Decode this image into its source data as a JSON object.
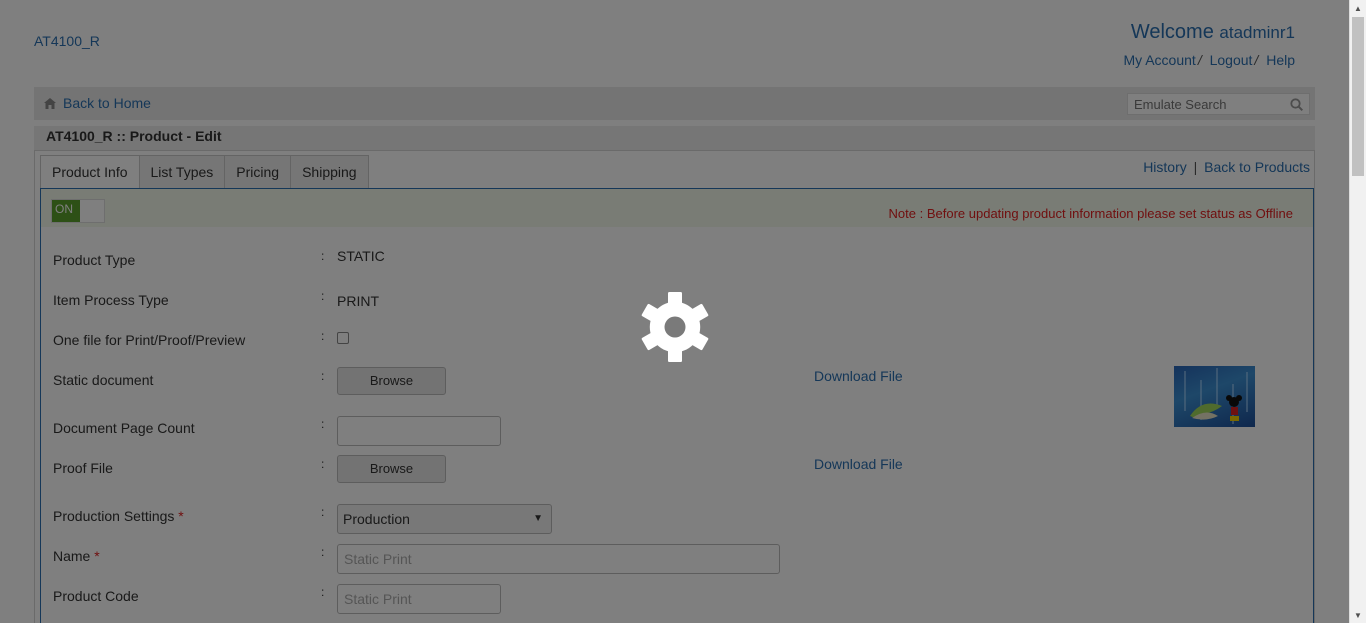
{
  "header": {
    "brand": "AT4100_R",
    "welcome_prefix": "Welcome",
    "username": "atadminr1",
    "links": [
      "My Account",
      "Logout",
      "Help"
    ],
    "separator": "/"
  },
  "homebar": {
    "back_home": "Back to Home",
    "search_placeholder": "Emulate Search"
  },
  "page": {
    "title": "AT4100_R :: Product - Edit"
  },
  "tabs": [
    "Product Info",
    "List Types",
    "Pricing",
    "Shipping"
  ],
  "right_links": {
    "history": "History",
    "separator": "|",
    "back_products": "Back to Products"
  },
  "status": {
    "toggle_label": "ON",
    "note": "Note : Before updating product information please set status as Offline"
  },
  "form": {
    "colon": ":",
    "product_type": {
      "label": "Product Type",
      "value": "STATIC"
    },
    "item_process_type": {
      "label": "Item Process Type",
      "value": "PRINT"
    },
    "one_file": {
      "label": "One file for Print/Proof/Preview",
      "checked": false
    },
    "static_document": {
      "label": "Static document",
      "button": "Browse",
      "download": "Download File"
    },
    "document_page_count": {
      "label": "Document Page Count",
      "value": ""
    },
    "proof_file": {
      "label": "Proof File",
      "button": "Browse",
      "download": "Download File"
    },
    "production_settings": {
      "label": "Production Settings",
      "required": "*",
      "selected": "Production"
    },
    "name": {
      "label": "Name",
      "required": "*",
      "placeholder": "Static Print"
    },
    "product_code": {
      "label": "Product Code",
      "placeholder": "Static Print"
    }
  },
  "colors": {
    "link": "#2a6fb0",
    "toggle_on": "#5aa02c",
    "note": "#e02020",
    "overlay": "rgba(0,0,0,0.5)"
  },
  "icons": {
    "home": "home-icon",
    "search": "search-icon",
    "loading": "gear-icon"
  }
}
